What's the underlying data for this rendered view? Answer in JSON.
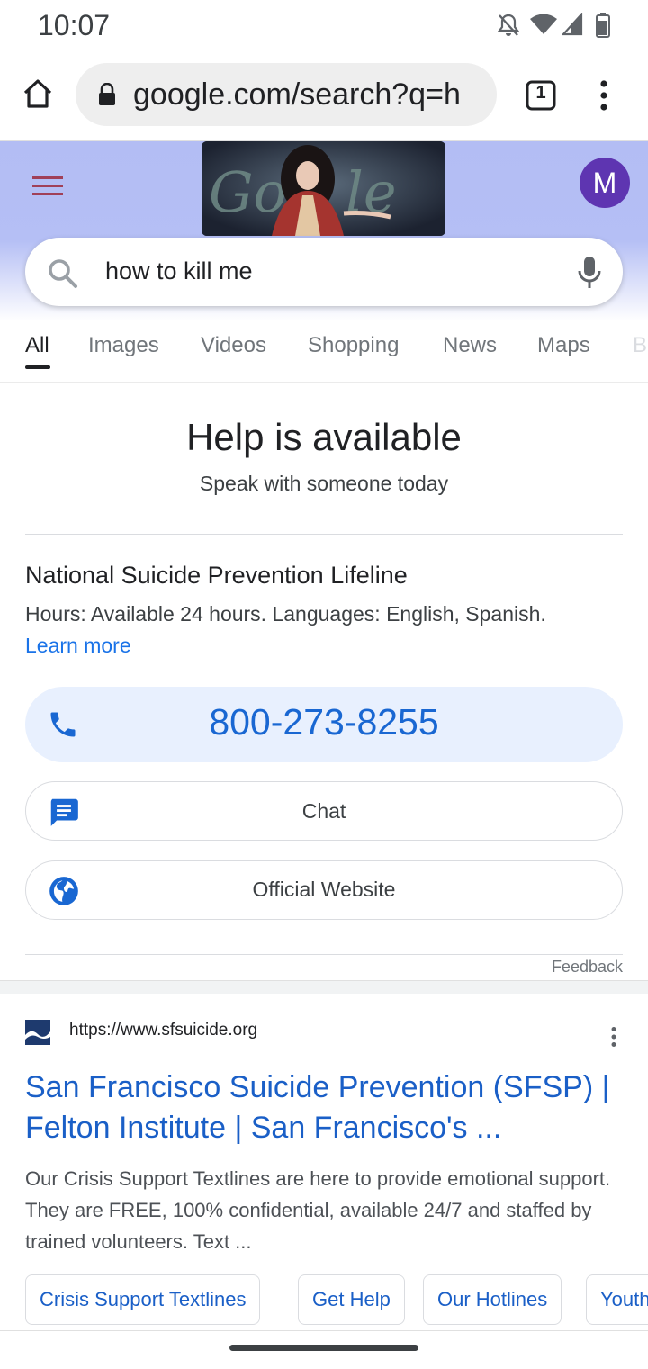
{
  "status_bar": {
    "time": "10:07"
  },
  "browser": {
    "url": "google.com/search?q=h",
    "tab_count": "1"
  },
  "header": {
    "avatar_letter": "M",
    "query": "how to kill me"
  },
  "tabs": [
    "All",
    "Images",
    "Videos",
    "Shopping",
    "News",
    "Maps",
    "B"
  ],
  "help_card": {
    "title": "Help is available",
    "subtitle": "Speak with someone today",
    "org_name": "National Suicide Prevention Lifeline",
    "hours": "Hours: Available 24 hours. Languages: English, Spanish.",
    "learn_more": "Learn more",
    "phone": "800-273-8255",
    "chat_label": "Chat",
    "website_label": "Official Website",
    "feedback": "Feedback"
  },
  "result": {
    "url": "https://www.sfsuicide.org",
    "title": "San Francisco Suicide Prevention (SFSP) | Felton Institute | San Francisco's ...",
    "snippet": "Our Crisis Support Textlines are here to provide emotional support. They are FREE, 100% confidential, available 24/7 and staffed by trained volunteers. Text ...",
    "chips": [
      "Crisis Support Textlines",
      "Get Help",
      "Our Hotlines",
      "Youth"
    ]
  },
  "colors": {
    "link_blue": "#1a73e8",
    "avatar_purple": "#5e35b1",
    "call_bg": "#e8f0fe"
  },
  "icons": [
    "notifications-off-icon",
    "wifi-icon",
    "signal-icon",
    "battery-icon",
    "home-icon",
    "lock-icon",
    "tabs-icon",
    "more-vert-icon",
    "menu-icon",
    "search-icon",
    "mic-icon",
    "phone-icon",
    "chat-icon",
    "globe-icon"
  ]
}
